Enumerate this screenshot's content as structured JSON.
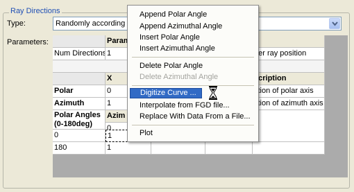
{
  "group": {
    "title": "Ray Directions"
  },
  "type_label": "Type:",
  "type_value": "Randomly according to",
  "parameters_label": "Parameters:",
  "grid": {
    "params_header": "Param",
    "num_directions": {
      "label": "Num Directions",
      "value": "1",
      "note": "per ray position"
    },
    "col_x": "X",
    "col_description": "scription",
    "polar": {
      "label": "Polar",
      "x": "0",
      "desc": "ction of polar axis"
    },
    "azimuth": {
      "label": "Azimuth",
      "x": "1",
      "desc": "ction of azimuth axis"
    },
    "polar_angles": {
      "label_line1": "Polar Angles",
      "label_line2": "(0-180deg)",
      "col_header": "Azim",
      "first_value": "0"
    },
    "rows": [
      {
        "polar": "0",
        "azimuth": "1"
      },
      {
        "polar": "180",
        "azimuth": "1"
      }
    ]
  },
  "menu": {
    "items": [
      {
        "label": "Append Polar Angle",
        "enabled": true
      },
      {
        "label": "Append Azimuthal Angle",
        "enabled": true
      },
      {
        "label": "Insert Polar Angle",
        "enabled": true
      },
      {
        "label": "Insert Azimuthal Angle",
        "enabled": true
      },
      {
        "label": "Delete Polar Angle",
        "enabled": true
      },
      {
        "label": "Delete Azimuthal Angle",
        "enabled": false
      },
      {
        "label": "Digitize Curve ...",
        "enabled": true,
        "highlighted": true
      },
      {
        "label": "Interpolate from FGD file...",
        "enabled": true
      },
      {
        "label": "Replace With Data From a File...",
        "enabled": true
      },
      {
        "label": "Plot",
        "enabled": true
      }
    ]
  },
  "cursor": {
    "icon": "hourglass-icon"
  },
  "colors": {
    "highlight": "#316ac5",
    "group_title": "#1f4fb5",
    "panel": "#ece9d8"
  }
}
